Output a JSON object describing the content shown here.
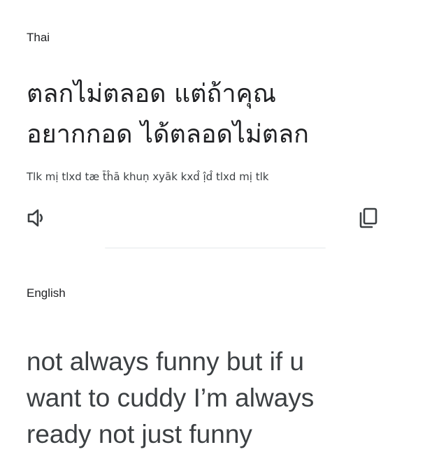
{
  "source": {
    "language": "Thai",
    "lines": [
      "ตลกไม่ตลอด แต่ถ้าคุณ",
      "อยากกอด ได้ตลอดไม่ตลก"
    ],
    "transliteration": "Tlk mị tlxd tæ t̄ĥā khuṇ xyāk kxd̂ ị̂d̂ tlxd mị tlk"
  },
  "target": {
    "language": "English",
    "lines": [
      "not always funny but if u",
      "want to cuddy I’m always",
      "ready not just funny"
    ]
  },
  "icons": {
    "listen": "speaker-icon",
    "copy": "copy-icon"
  },
  "colors": {
    "text": "#202124",
    "secondary_text": "#3c4043",
    "divider": "#f1f3f4"
  }
}
